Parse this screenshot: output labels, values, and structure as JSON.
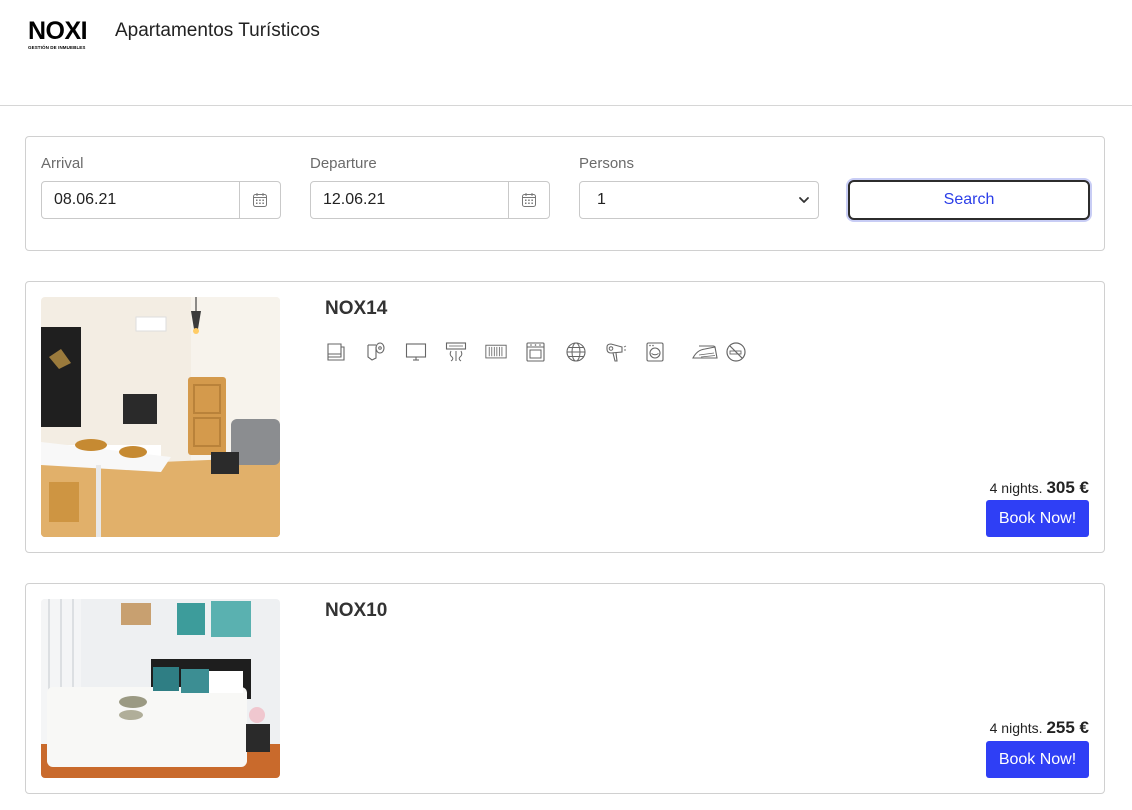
{
  "header": {
    "logo_text": "NOXI",
    "logo_subtext": "GESTIÓN DE INMUEBLES",
    "site_title": "Apartamentos Turísticos"
  },
  "search": {
    "arrival_label": "Arrival",
    "arrival_value": "08.06.21",
    "departure_label": "Departure",
    "departure_value": "12.06.21",
    "persons_label": "Persons",
    "persons_value": "1",
    "search_button": "Search"
  },
  "listings": [
    {
      "name": "NOX14",
      "nights": "4 nights.",
      "price": "305 €",
      "book_label": "Book Now!",
      "amenities": [
        "towel-icon",
        "toilet-paper-icon",
        "tv-icon",
        "air-conditioning-icon",
        "heater-icon",
        "oven-icon",
        "wifi-icon",
        "hair-dryer-icon",
        "washing-machine-icon",
        "iron-icon",
        "no-smoking-icon"
      ]
    },
    {
      "name": "NOX10",
      "nights": "4 nights.",
      "price": "255 €",
      "book_label": "Book Now!",
      "amenities": []
    }
  ],
  "colors": {
    "primary": "#2f3ff5",
    "search_text": "#2b3ee8",
    "border": "#d0d0d0"
  }
}
